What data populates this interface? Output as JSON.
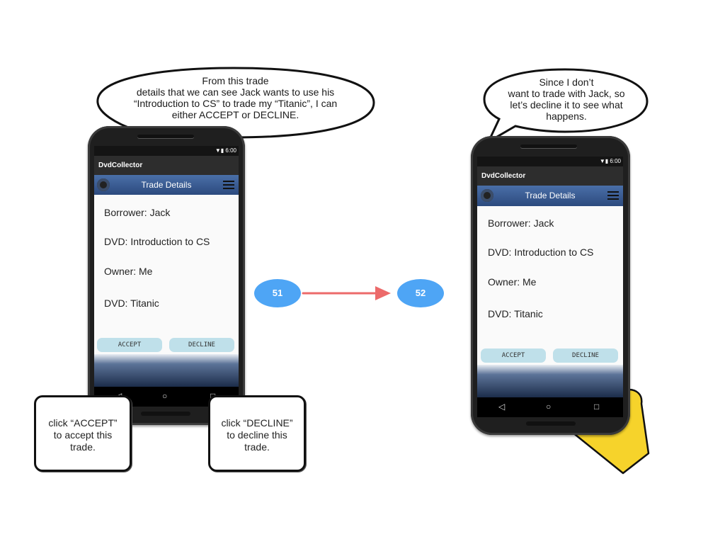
{
  "bubbles": {
    "left_lines": [
      "From this trade",
      "details that we can see Jack wants to use his",
      "“Introduction to CS” to trade my “Titanic”, I can",
      "either ACCEPT or DECLINE."
    ],
    "right_lines": [
      "Since I don’t",
      "want to trade with Jack, so",
      "let’s decline it to see what",
      "happens."
    ]
  },
  "phone": {
    "status_time": "6:00",
    "status_icons": "▼▮",
    "app_name": "DvdCollector",
    "screen_title": "Trade Details",
    "fields": {
      "borrower": "Borrower: Jack",
      "dvd_borrower": "DVD: Introduction to CS",
      "owner": "Owner: Me",
      "dvd_owner": "DVD: Titanic"
    },
    "accept_label": "ACCEPT",
    "decline_label": "DECLINE",
    "nav_back": "◁",
    "nav_home": "○",
    "nav_recent": "□"
  },
  "steps": {
    "from": "51",
    "to": "52"
  },
  "callouts": {
    "accept_lines": [
      "click “ACCEPT”",
      "to accept this",
      "trade."
    ],
    "decline_lines": [
      "click “DECLINE”",
      "to decline this",
      "trade."
    ]
  },
  "colors": {
    "toolbar": "#3a5a90",
    "button": "#bfe0ea",
    "step": "#4ea5f5",
    "arrow": "#ec6a6a",
    "hand": "#f6d32b"
  }
}
